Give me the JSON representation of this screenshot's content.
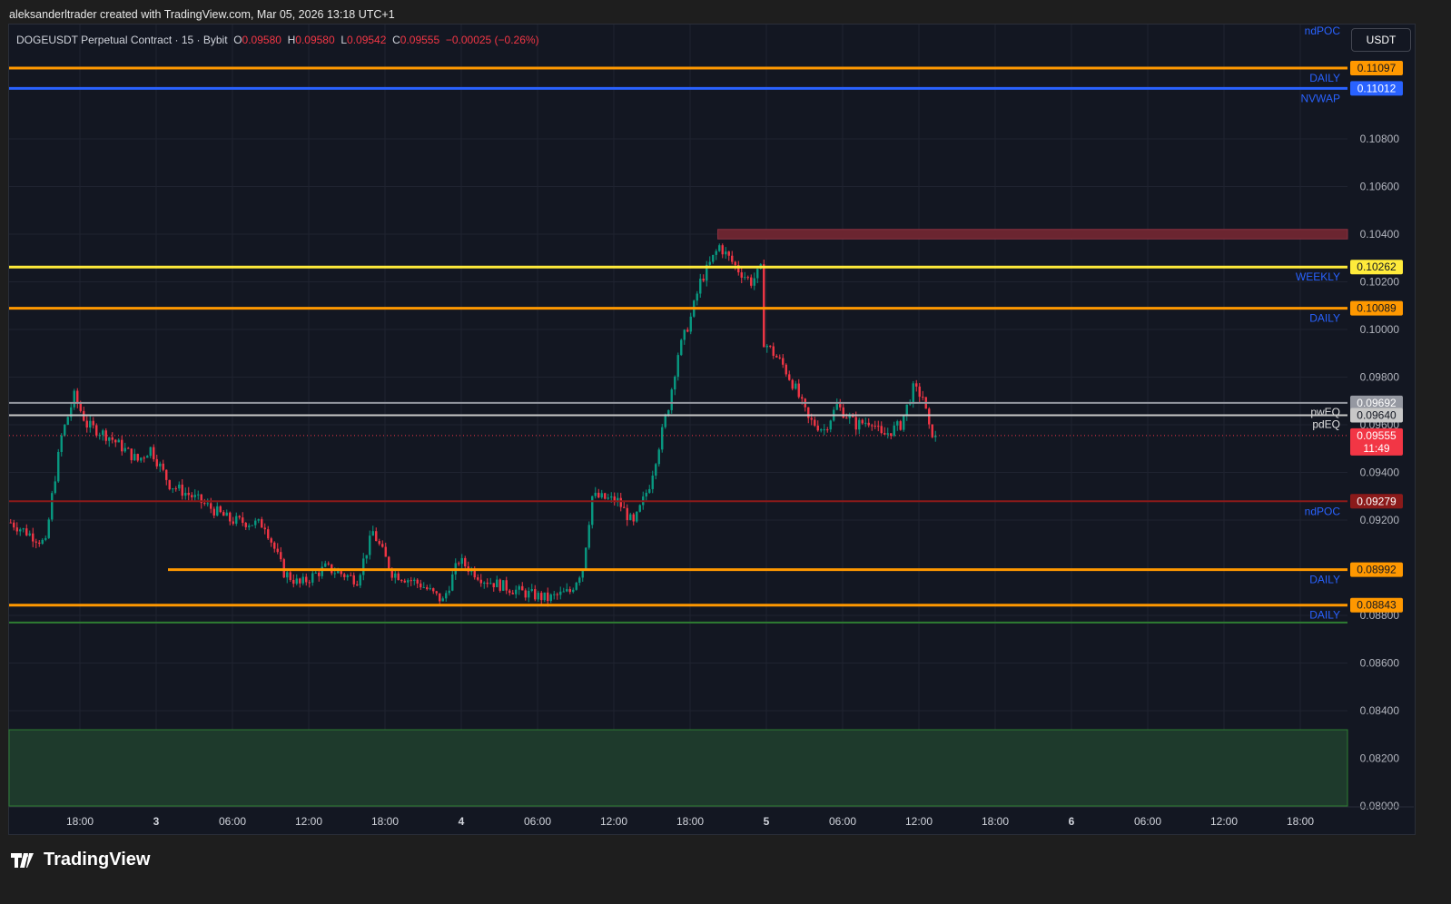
{
  "credit": "aleksanderltrader created with TradingView.com, Mar 05, 2026 13:18 UTC+1",
  "legend": {
    "symbol": "DOGEUSDT Perpetual Contract · 15 · Bybit",
    "o_label": "O",
    "o": "0.09580",
    "h_label": "H",
    "h": "0.09580",
    "l_label": "L",
    "l": "0.09542",
    "c_label": "C",
    "c": "0.09555",
    "change": "−0.00025 (−0.26%)"
  },
  "currency_button": "USDT",
  "brand": "TradingView",
  "colors": {
    "up": "#089981",
    "down": "#f23645",
    "orange": "#ff9800",
    "blue": "#2962ff",
    "yellow": "#ffeb3b"
  },
  "chart_data": {
    "type": "candlestick",
    "price_range": [
      0.08,
      0.112
    ],
    "price_ticks": [
      "0.10800",
      "0.10600",
      "0.10400",
      "0.10200",
      "0.10000",
      "0.09800",
      "0.09600",
      "0.09400",
      "0.09200",
      "0.08800",
      "0.08600",
      "0.08400",
      "0.08200",
      "0.08000"
    ],
    "time_ticks": [
      "18:00",
      "3",
      "06:00",
      "12:00",
      "18:00",
      "4",
      "06:00",
      "12:00",
      "18:00",
      "5",
      "06:00",
      "12:00",
      "18:00",
      "6",
      "06:00",
      "12:00",
      "18:00"
    ],
    "bar_interval": "15m",
    "close_path": [
      [
        0,
        0.0919
      ],
      [
        11,
        0.091
      ],
      [
        13,
        0.093
      ],
      [
        16,
        0.0955
      ],
      [
        20,
        0.0972
      ],
      [
        24,
        0.096
      ],
      [
        31,
        0.0955
      ],
      [
        40,
        0.0945
      ],
      [
        44,
        0.095
      ],
      [
        50,
        0.0935
      ],
      [
        57,
        0.093
      ],
      [
        69,
        0.092
      ],
      [
        80,
        0.0918
      ],
      [
        86,
        0.0898
      ],
      [
        91,
        0.0893
      ],
      [
        99,
        0.09
      ],
      [
        109,
        0.0895
      ],
      [
        114,
        0.0915
      ],
      [
        120,
        0.0898
      ],
      [
        129,
        0.0893
      ],
      [
        136,
        0.0886
      ],
      [
        141,
        0.0903
      ],
      [
        149,
        0.0895
      ],
      [
        160,
        0.089
      ],
      [
        169,
        0.0887
      ],
      [
        176,
        0.089
      ],
      [
        180,
        0.09
      ],
      [
        183,
        0.093
      ],
      [
        191,
        0.0928
      ],
      [
        196,
        0.0918
      ],
      [
        201,
        0.0935
      ],
      [
        207,
        0.0968
      ],
      [
        210,
        0.099
      ],
      [
        214,
        0.1005
      ],
      [
        217,
        0.102
      ],
      [
        223,
        0.1035
      ],
      [
        229,
        0.1025
      ],
      [
        233,
        0.102
      ],
      [
        236,
        0.1025
      ],
      [
        237,
        0.0995
      ],
      [
        243,
        0.0985
      ],
      [
        247,
        0.0975
      ],
      [
        251,
        0.0962
      ],
      [
        256,
        0.0958
      ],
      [
        260,
        0.0968
      ],
      [
        266,
        0.096
      ],
      [
        271,
        0.0962
      ],
      [
        274,
        0.0955
      ],
      [
        280,
        0.096
      ],
      [
        284,
        0.0975
      ],
      [
        287,
        0.0972
      ],
      [
        289,
        0.0958
      ],
      [
        291,
        0.09555
      ]
    ],
    "levels": [
      {
        "price": 0.11097,
        "label": "0.11097",
        "tag": "DAILY",
        "color": "#ff9800",
        "width": 3
      },
      {
        "price": 0.11012,
        "label": "0.11012",
        "tag": "NVWAP",
        "color": "#2962ff",
        "width": 3
      },
      {
        "price": 0.10262,
        "label": "0.10262",
        "tag": "WEEKLY",
        "color": "#ffeb3b",
        "width": 3
      },
      {
        "price": 0.10089,
        "label": "0.10089",
        "tag": "DAILY",
        "color": "#ff9800",
        "width": 3
      },
      {
        "price": 0.09692,
        "label": "0.09692",
        "tag": "pwEQ",
        "color": "#9598a1",
        "width": 2
      },
      {
        "price": 0.0964,
        "label": "0.09640",
        "tag": "pdEQ",
        "color": "#c8c8c8",
        "width": 2
      },
      {
        "price": 0.09279,
        "label": "0.09279",
        "tag": "ndPOC",
        "color": "#8b1a1a",
        "width": 2
      },
      {
        "price": 0.08992,
        "label": "0.08992",
        "tag": "DAILY",
        "color": "#ff9800",
        "width": 3,
        "from_bar": 50
      },
      {
        "price": 0.08843,
        "label": "0.08843",
        "tag": "DAILY",
        "color": "#ff9800",
        "width": 3
      },
      {
        "price": 0.0877,
        "color": "#2e7d32",
        "width": 2
      }
    ],
    "top_tag": "ndPOC",
    "last_price": {
      "label": "0.09555",
      "countdown": "11:49",
      "price": 0.09555
    },
    "zones": [
      {
        "from": 0.1038,
        "to": 0.1042,
        "color": "#6b2530",
        "from_bar": 223
      },
      {
        "from": 0.08,
        "to": 0.0832,
        "color": "#1e3a2c",
        "from_bar": 0
      }
    ]
  }
}
